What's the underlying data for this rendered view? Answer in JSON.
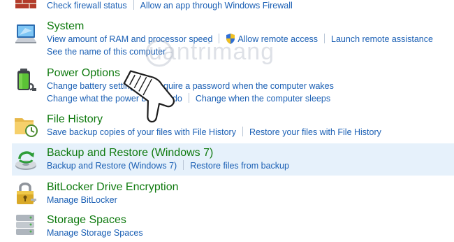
{
  "firewall": {
    "links": [
      "Check firewall status",
      "Allow an app through Windows Firewall"
    ]
  },
  "system": {
    "title": "System",
    "links_row1": [
      "View amount of RAM and processor speed",
      "Allow remote access",
      "Launch remote assistance"
    ],
    "links_row2": [
      "See the name of this computer"
    ]
  },
  "power": {
    "title": "Power Options",
    "links_row1": [
      "Change battery settings",
      "Require a password when the computer wakes"
    ],
    "links_row2": [
      "Change what the power buttons do",
      "Change when the computer sleeps"
    ]
  },
  "file_history": {
    "title": "File History",
    "links": [
      "Save backup copies of your files with File History",
      "Restore your files with File History"
    ]
  },
  "backup": {
    "title": "Backup and Restore (Windows 7)",
    "links": [
      "Backup and Restore (Windows 7)",
      "Restore files from backup"
    ]
  },
  "bitlocker": {
    "title": "BitLocker Drive Encryption",
    "links": [
      "Manage BitLocker"
    ]
  },
  "storage": {
    "title": "Storage Spaces",
    "links": [
      "Manage Storage Spaces"
    ]
  },
  "watermark": {
    "text": "uantrimang"
  },
  "colors": {
    "title_green": "#0f7a0f",
    "link_blue": "#1a5fb4",
    "highlight": "#e6f1fb"
  }
}
